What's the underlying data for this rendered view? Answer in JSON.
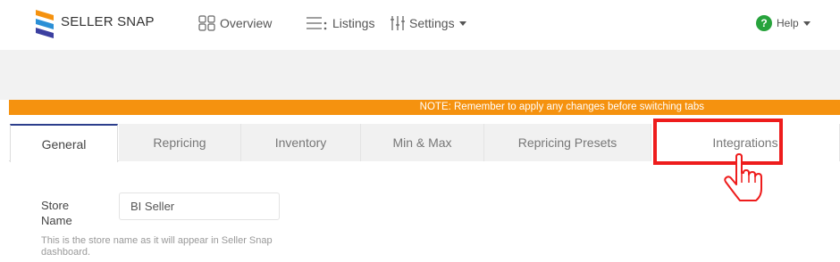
{
  "brand": {
    "name": "SELLER SNAP"
  },
  "nav": {
    "overview": "Overview",
    "listings": "Listings",
    "settings": "Settings",
    "help": "Help"
  },
  "notice": "NOTE: Remember to apply any changes before switching tabs",
  "tabs": [
    {
      "label": "General",
      "active": true
    },
    {
      "label": "Repricing",
      "active": false
    },
    {
      "label": "Inventory",
      "active": false
    },
    {
      "label": "Min & Max",
      "active": false
    },
    {
      "label": "Repricing Presets",
      "active": false
    },
    {
      "label": "Integrations",
      "active": false
    }
  ],
  "form": {
    "store_name_label": "Store Name",
    "store_name_value": "BI Seller",
    "store_name_help": "This is the store name as it will appear in Seller Snap dashboard."
  },
  "colors": {
    "notice_bg": "#f5920f",
    "highlight": "#ee1c1c",
    "active_tab_accent": "#2c3e8c"
  }
}
